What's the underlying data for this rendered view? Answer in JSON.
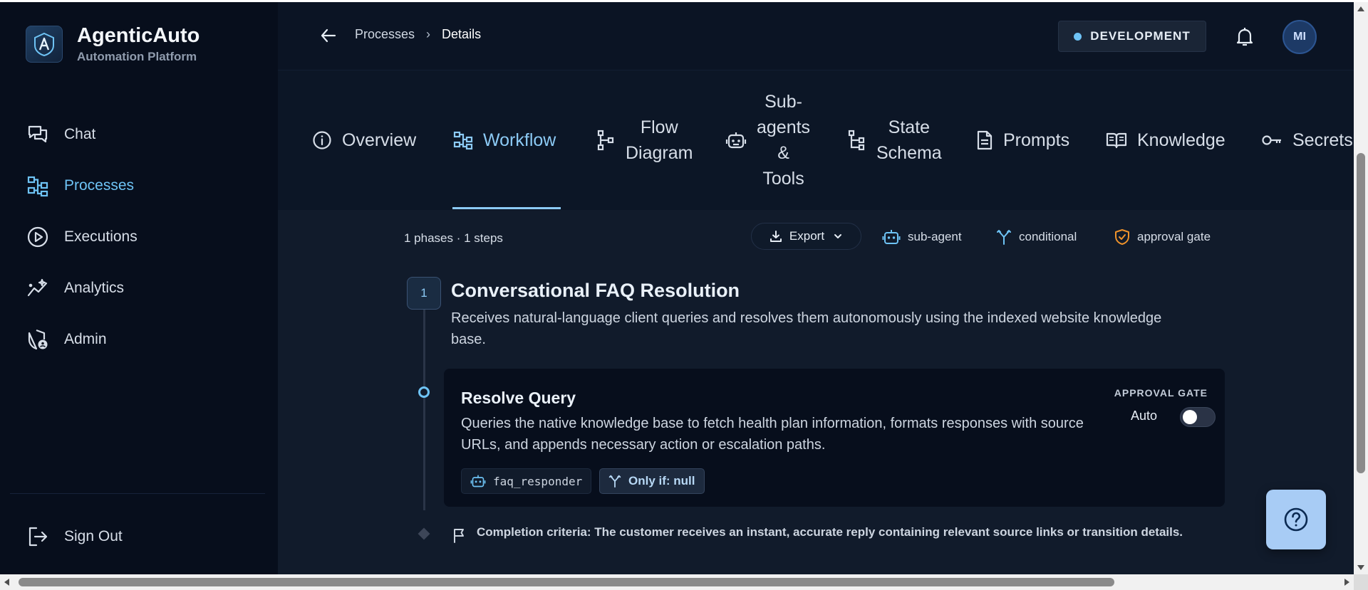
{
  "brand": {
    "name": "AgenticAuto",
    "subtitle": "Automation Platform"
  },
  "sidebar": {
    "items": [
      {
        "label": "Chat",
        "icon": "chat-icon",
        "active": false
      },
      {
        "label": "Processes",
        "icon": "processes-icon",
        "active": true
      },
      {
        "label": "Executions",
        "icon": "play-circle-icon",
        "active": false
      },
      {
        "label": "Analytics",
        "icon": "analytics-icon",
        "active": false
      },
      {
        "label": "Admin",
        "icon": "shield-user-icon",
        "active": false
      }
    ],
    "sign_out": "Sign Out"
  },
  "header": {
    "breadcrumb": {
      "parent": "Processes",
      "separator": "›",
      "current": "Details"
    },
    "environment": "DEVELOPMENT",
    "avatar_initials": "MI"
  },
  "tabs": [
    {
      "label": "Overview",
      "icon": "info-icon",
      "active": false
    },
    {
      "label": "Workflow",
      "icon": "workflow-icon",
      "active": true
    },
    {
      "label_lines": [
        "Flow",
        "Diagram"
      ],
      "icon": "flow-diagram-icon",
      "active": false
    },
    {
      "label_lines": [
        "Sub-",
        "agents",
        "&",
        "Tools"
      ],
      "icon": "robot-icon",
      "active": false
    },
    {
      "label_lines": [
        "State",
        "Schema"
      ],
      "icon": "schema-icon",
      "active": false
    },
    {
      "label": "Prompts",
      "icon": "document-icon",
      "active": false
    },
    {
      "label": "Knowledge",
      "icon": "book-icon",
      "active": false
    },
    {
      "label": "Secrets",
      "icon": "key-icon",
      "active": false
    }
  ],
  "workflow": {
    "summary": "1 phases · 1 steps",
    "export_label": "Export",
    "legend": {
      "subagent": "sub-agent",
      "conditional": "conditional",
      "approval": "approval gate"
    },
    "phase": {
      "number": "1",
      "title": "Conversational FAQ Resolution",
      "description": "Receives natural-language client queries and resolves them autonomously using the indexed website knowledge base."
    },
    "step": {
      "title": "Resolve Query",
      "description": "Queries the native knowledge base to fetch health plan information, formats responses with source URLs, and appends necessary action or escalation paths.",
      "gate_label": "APPROVAL GATE",
      "gate_mode": "Auto",
      "gate_enabled": false,
      "agent_chip": "faq_responder",
      "condition_chip": "Only if: null"
    },
    "completion": "Completion criteria: The customer receives an instant, accurate reply containing relevant source links or transition details."
  },
  "colors": {
    "accent": "#6ec3f5",
    "approval": "#f0932b",
    "background": "#0b1220"
  }
}
